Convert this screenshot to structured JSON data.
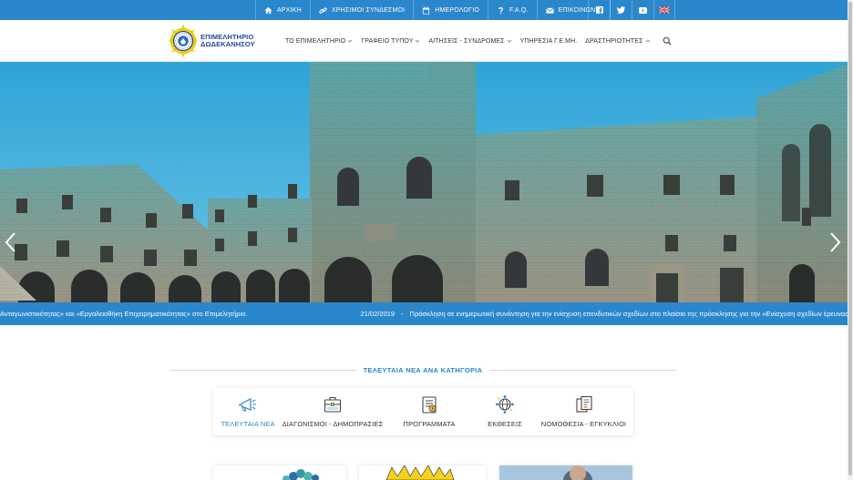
{
  "topbar": {
    "links": [
      {
        "label": "ΑΡΧΙΚΗ",
        "icon": "home-icon"
      },
      {
        "label": "ΧΡΗΣΙΜΟΙ ΣΥΝΔΕΣΜΟΙ",
        "icon": "link-icon"
      },
      {
        "label": "ΗΜΕΡΟΛΟΓΙΟ",
        "icon": "calendar-icon"
      },
      {
        "label": "F.A.Q.",
        "icon": "question-icon"
      },
      {
        "label": "ΕΠΙΚΟΙΝΩΝΙΑ",
        "icon": "envelope-icon"
      }
    ],
    "social": [
      "facebook-icon",
      "twitter-icon",
      "youtube-icon",
      "uk-flag-icon"
    ]
  },
  "header": {
    "logo_line1": "ΕΠΙΜΕΛΗΤΗΡΙΟ",
    "logo_line2": "ΔΩΔΕΚΑΝΗΣΟΥ",
    "nav": [
      {
        "label": "ΤΟ ΕΠΙΜΕΛΗΤΗΡΙΟ",
        "dropdown": true
      },
      {
        "label": "ΓΡΑΦΕΙΟ ΤΥΠΟΥ",
        "dropdown": true
      },
      {
        "label": "ΑΙΤΗΣΕΙΣ - ΣΥΝΔΡΟΜΕΣ",
        "dropdown": true
      },
      {
        "label": "ΥΠΗΡΕΣΙΑ Γ.Ε.ΜΗ.",
        "dropdown": false
      },
      {
        "label": "ΔΡΑΣΤΗΡΙΟΤΗΤΕΣ",
        "dropdown": true
      }
    ]
  },
  "slider": {
    "active_slide": 1,
    "slide_count": 2
  },
  "ticker": {
    "item1": "Ανταγωνιστικότητας» και «Εργαλειοθήκη Επιχειρηματικότητας» στο Επιμελητήριο.",
    "date2": "21/02/2019",
    "separator": "-",
    "item2": "Πρόσκληση σε ενημερωτική συνάντηση για την ενίσχυση επενδυτικών σχεδίων στο πλαίσιο της πρόσκλησης για την «Ενίσχυση σχεδίων έρευνας, ανάπτυ"
  },
  "news_section": {
    "title": "ΤΕΛΕΥΤΑΙΑ ΝΕΑ ΑΝΑ ΚΑΤΗΓΟΡΙΑ",
    "categories": [
      {
        "label": "ΤΕΛΕΥΤΑΙΑ ΝΕΑ",
        "icon": "megaphone-icon",
        "active": true
      },
      {
        "label": "ΔΙΑΓΩΝΙΣΜΟΙ - ΔΗΜΟΠΡΑΣΙΕΣ",
        "icon": "briefcase-icon",
        "active": false
      },
      {
        "label": "ΠΡΟΓΡΑΜΜΑΤΑ",
        "icon": "schedule-icon",
        "active": false
      },
      {
        "label": "ΕΚΘΕΣΕΙΣ",
        "icon": "globe-network-icon",
        "active": false
      },
      {
        "label": "ΝΟΜΟΘΕΣΙΑ - ΕΓΚΥΚΛΙΟΙ",
        "icon": "documents-icon",
        "active": false
      }
    ]
  },
  "colors": {
    "brand_blue": "#2a87cc",
    "logo_blue": "#1f4c94",
    "logo_yellow": "#f2d21a"
  }
}
